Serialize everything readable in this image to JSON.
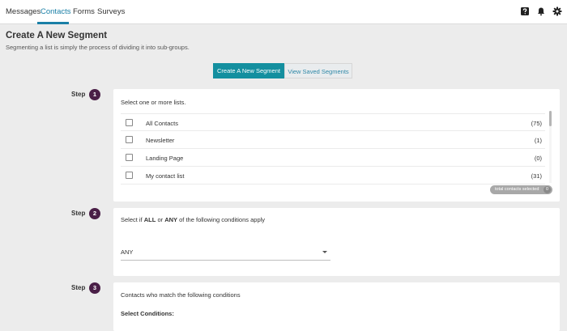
{
  "nav": {
    "items": [
      {
        "label": "Messages"
      },
      {
        "label": "Contacts",
        "active": true
      },
      {
        "label": "Forms"
      },
      {
        "label": "Surveys"
      }
    ],
    "icons": [
      "help-icon",
      "bell-icon",
      "gear-icon"
    ],
    "accent_color": "#1a7fa6"
  },
  "header": {
    "title": "Create A New Segment",
    "subtitle": "Segmenting a list is simply the process of dividing it into sub-groups."
  },
  "actions": {
    "create_label": "Create A New Segment",
    "saved_label": "View Saved Segments",
    "primary_color": "#138f9f"
  },
  "step_label": "Step",
  "steps": [
    {
      "number": "1",
      "heading": "Select one or more lists.",
      "lists": [
        {
          "name": "All Contacts",
          "count": "(75)"
        },
        {
          "name": "Newsletter",
          "count": "(1)"
        },
        {
          "name": "Landing Page",
          "count": "(0)"
        },
        {
          "name": "My contact list",
          "count": "(31)"
        }
      ],
      "total_label": "total contacts selected",
      "total_count": "0"
    },
    {
      "number": "2",
      "heading_pre": "Select if ",
      "heading_all": "ALL",
      "heading_mid": " or ",
      "heading_any": "ANY",
      "heading_post": " of the following conditions apply",
      "select_value": "ANY"
    },
    {
      "number": "3",
      "heading": "Contacts who match the following conditions",
      "conditions_label": "Select Conditions:"
    }
  ],
  "step_badge_color": "#4a1f47"
}
